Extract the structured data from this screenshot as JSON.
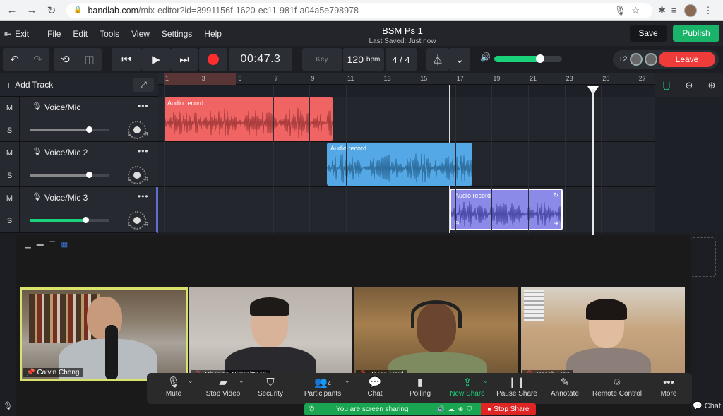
{
  "browser": {
    "url_host": "bandlab.com",
    "url_path": "/mix-editor?id=3991156f-1620-ec11-981f-a04a5e798978"
  },
  "menu": {
    "exit": "Exit",
    "items": [
      "File",
      "Edit",
      "Tools",
      "View",
      "Settings",
      "Help"
    ]
  },
  "project": {
    "title": "BSM Ps 1",
    "saved": "Last Saved: Just now"
  },
  "actions": {
    "save": "Save",
    "publish": "Publish"
  },
  "transport": {
    "time": "00:47.3",
    "key_label": "Key",
    "bpm": "120",
    "bpm_unit": "bpm",
    "signature": "4 / 4",
    "volume_level": 0.68
  },
  "collab": {
    "count": "+2",
    "leave": "Leave"
  },
  "tracks": {
    "add_label": "Add Track",
    "list": [
      {
        "name": "Voice/Mic",
        "mute": "M",
        "solo": "S",
        "level": 0.74,
        "color": "#888888"
      },
      {
        "name": "Voice/Mic 2",
        "mute": "M",
        "solo": "S",
        "level": 0.74,
        "color": "#888888"
      },
      {
        "name": "Voice/Mic 3",
        "mute": "M",
        "solo": "S",
        "level": 0.7,
        "color": "#1ad27a"
      }
    ],
    "pan_l": "L",
    "pan_r": "R"
  },
  "ruler": {
    "ticks": [
      "1",
      "3",
      "5",
      "7",
      "9",
      "11",
      "13",
      "15",
      "17",
      "19",
      "21",
      "23",
      "25",
      "27"
    ]
  },
  "clips": [
    {
      "label": "Audio record",
      "color": "#f06464",
      "wave": "#a83c3c"
    },
    {
      "label": "Audio record",
      "color": "#55a8e6",
      "wave": "#2e6e9e"
    },
    {
      "label": "Audio record",
      "color": "#8c8ae8",
      "wave": "#4c4aa8"
    }
  ],
  "zoom": {
    "participants": [
      {
        "name": "Calvin Chong",
        "active": true
      },
      {
        "name": "Chanon Nimmitthan"
      },
      {
        "name": "Jaron Paul"
      },
      {
        "name": "Sarah Han"
      }
    ],
    "toolbar": {
      "mute": "Mute",
      "stop_video": "Stop Video",
      "security": "Security",
      "participants": "Participants",
      "participants_count": "4",
      "chat": "Chat",
      "polling": "Polling",
      "new_share": "New Share",
      "pause_share": "Pause Share",
      "annotate": "Annotate",
      "remote_control": "Remote Control",
      "more": "More"
    },
    "sharing_status": "You are screen sharing",
    "stop_share": "Stop Share",
    "chat": "Chat"
  }
}
